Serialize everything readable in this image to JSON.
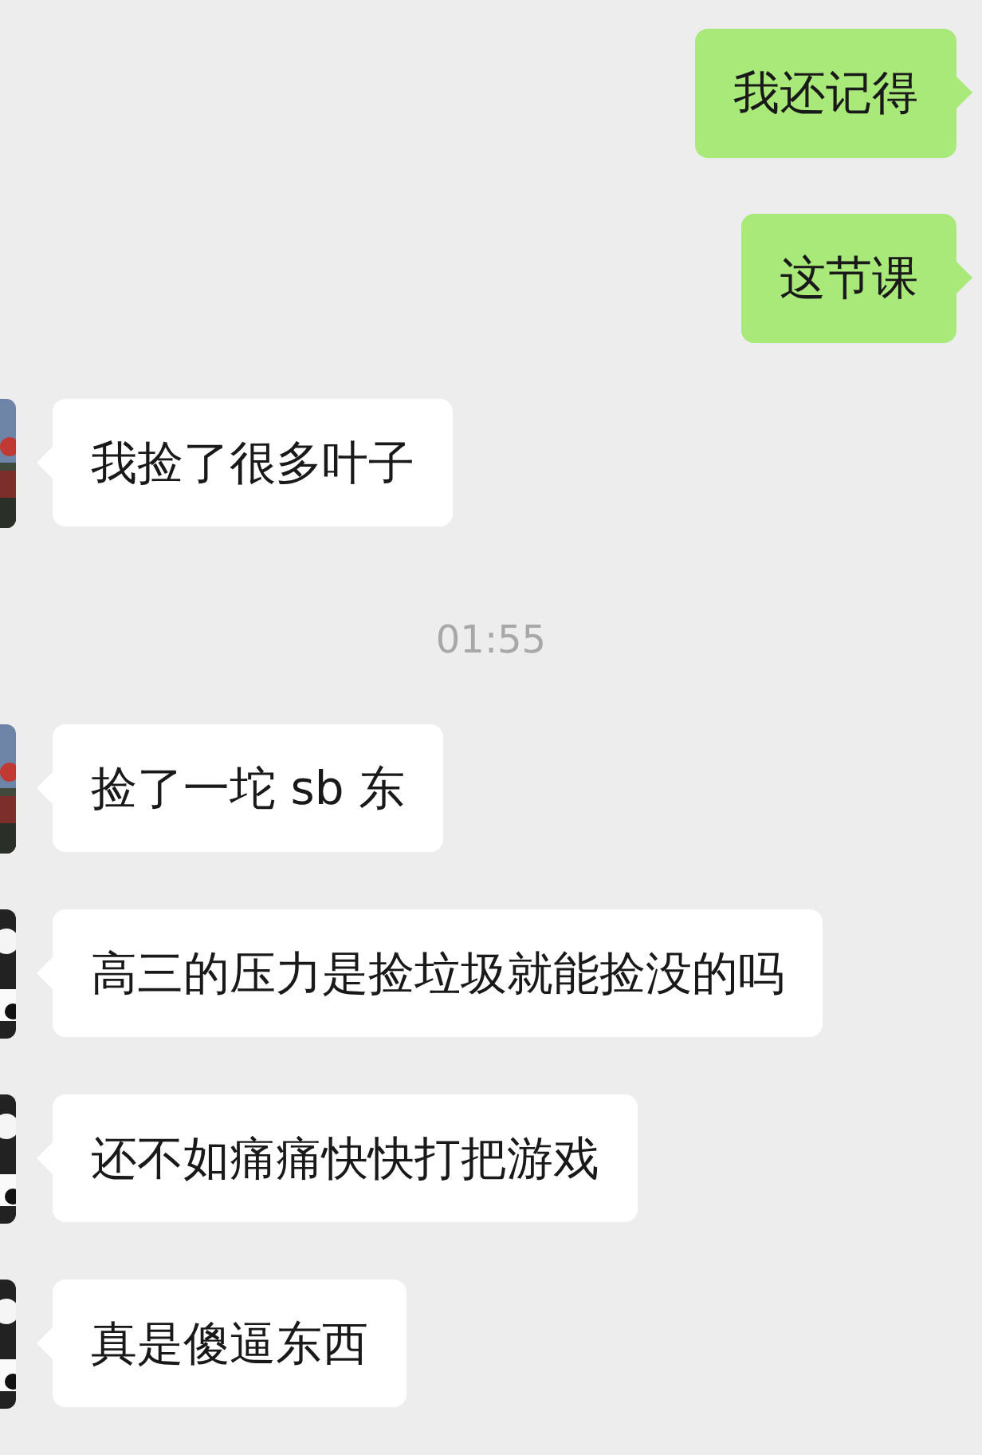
{
  "messages": [
    {
      "kind": "outgoing",
      "text": "我还记得"
    },
    {
      "kind": "outgoing",
      "text": "这节课"
    },
    {
      "kind": "incoming",
      "text": "我捡了很多叶子"
    },
    {
      "kind": "timestamp",
      "text": "01:55"
    },
    {
      "kind": "incoming",
      "text": "捡了一坨 sb 东"
    },
    {
      "kind": "incoming",
      "text": "高三的压力是捡垃圾就能捡没的吗"
    },
    {
      "kind": "incoming",
      "text": "还不如痛痛快快打把游戏"
    },
    {
      "kind": "incoming",
      "text": "真是傻逼东西"
    }
  ]
}
